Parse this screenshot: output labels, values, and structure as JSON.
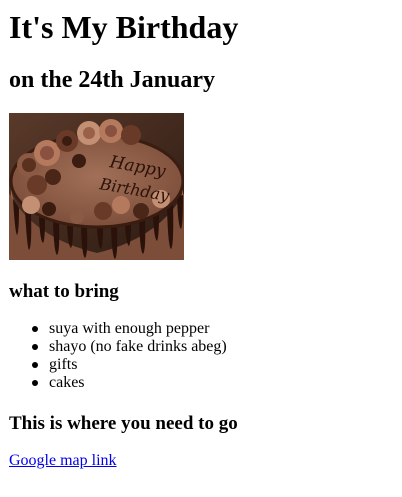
{
  "heading": "It's My Birthday",
  "subheading": "on the 24th January",
  "image": {
    "icon": "birthday-cake-image",
    "text": [
      "Happy",
      "Birthday"
    ],
    "colors": {
      "background": "#3a2418",
      "frosting": "#8a5a44",
      "drip": "#2a120a",
      "rosette": "#b57a5e"
    }
  },
  "bring": {
    "title": "what to bring",
    "items": [
      "suya with enough pepper",
      "shayo (no fake drinks abeg)",
      "gifts",
      "cakes"
    ]
  },
  "location": {
    "title": "This is where you need to go",
    "link_text": "Google map link",
    "link_color": "#0000ee"
  }
}
